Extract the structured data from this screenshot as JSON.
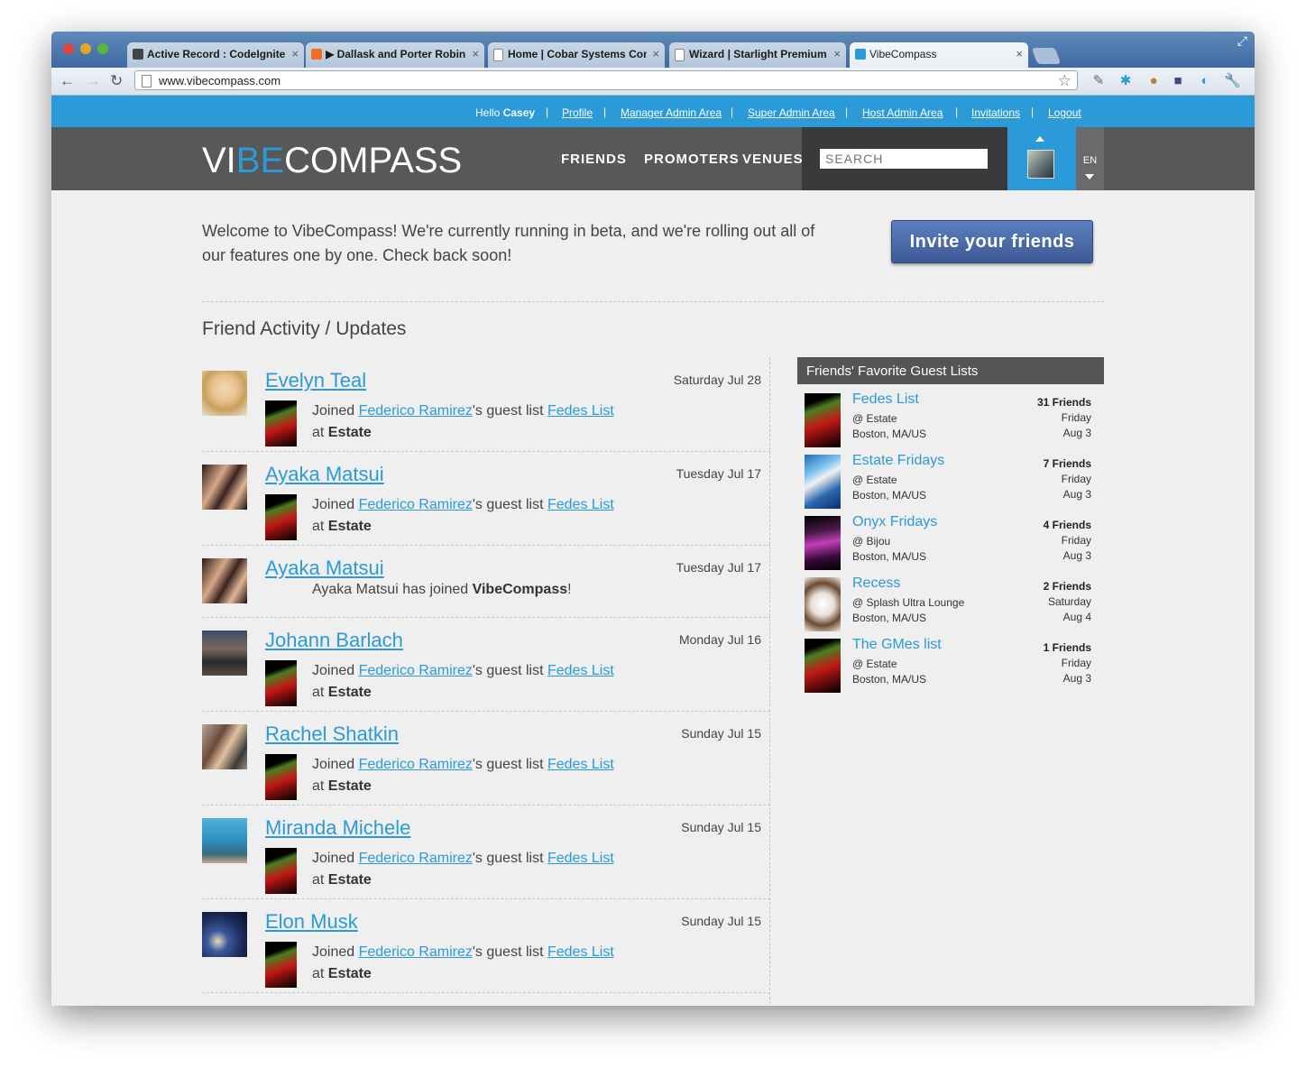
{
  "browser": {
    "tabs": [
      {
        "label": "Active Record : CodeIgniter U",
        "fav_color": "#444444"
      },
      {
        "label": "▶ Dallask and Porter Robinson",
        "fav_color": "#f26f21"
      },
      {
        "label": "Home | Cobar Systems Contr",
        "fav_color": "#ffffff"
      },
      {
        "label": "Wizard | Starlight Premium A",
        "fav_color": "#ffffff"
      },
      {
        "label": "VibeCompass",
        "fav_color": "#2a9ad8"
      }
    ],
    "url": "www.vibecompass.com"
  },
  "userbar": {
    "hello": "Hello",
    "user": "Casey",
    "links": [
      "Profile",
      "Manager Admin Area",
      "Super Admin Area",
      "Host Admin Area",
      "Invitations",
      "Logout"
    ]
  },
  "header": {
    "logo_pre": "VI",
    "logo_be": "BE",
    "logo_post": "COMPASS",
    "nav": [
      "FRIENDS",
      "PROMOTERS",
      "VENUES"
    ],
    "search_placeholder": "SEARCH",
    "lang": "EN"
  },
  "welcome": {
    "text": "Welcome to VibeCompass! We're currently running in beta, and we're rolling out all of our features one by one. Check back soon!",
    "invite_button": "Invite your friends"
  },
  "feed": {
    "title": "Friend Activity / Updates",
    "items": [
      {
        "name": "Evelyn Teal",
        "date": "Saturday Jul 28",
        "type": "joined_list",
        "host": "Federico Ramirez",
        "list": "Fedes List",
        "venue": "Estate"
      },
      {
        "name": "Ayaka Matsui",
        "date": "Tuesday Jul 17",
        "type": "joined_list",
        "host": "Federico Ramirez",
        "list": "Fedes List",
        "venue": "Estate"
      },
      {
        "name": "Ayaka Matsui",
        "date": "Tuesday Jul 17",
        "type": "joined_site",
        "text_pre": "Ayaka Matsui has joined",
        "text_brand": "VibeCompass",
        "text_post": "!"
      },
      {
        "name": "Johann Barlach",
        "date": "Monday Jul 16",
        "type": "joined_list",
        "host": "Federico Ramirez",
        "list": "Fedes List",
        "venue": "Estate"
      },
      {
        "name": "Rachel Shatkin",
        "date": "Sunday Jul 15",
        "type": "joined_list",
        "host": "Federico Ramirez",
        "list": "Fedes List",
        "venue": "Estate"
      },
      {
        "name": "Miranda Michele",
        "date": "Sunday Jul 15",
        "type": "joined_list",
        "host": "Federico Ramirez",
        "list": "Fedes List",
        "venue": "Estate"
      },
      {
        "name": "Elon Musk",
        "date": "Sunday Jul 15",
        "type": "joined_list",
        "host": "Federico Ramirez",
        "list": "Fedes List",
        "venue": "Estate"
      }
    ],
    "phrases": {
      "joined": "Joined",
      "guest_list": "'s guest list",
      "at": "at"
    }
  },
  "sidebar": {
    "title": "Friends' Favorite Guest Lists",
    "lists": [
      {
        "name": "Fedes List",
        "venue": "@ Estate",
        "city": "Boston, MA/US",
        "friends": "31 Friends",
        "day": "Friday",
        "date": "Aug 3"
      },
      {
        "name": "Estate Fridays",
        "venue": "@ Estate",
        "city": "Boston, MA/US",
        "friends": "7 Friends",
        "day": "Friday",
        "date": "Aug 3"
      },
      {
        "name": "Onyx Fridays",
        "venue": "@ Bijou",
        "city": "Boston, MA/US",
        "friends": "4 Friends",
        "day": "Friday",
        "date": "Aug 3"
      },
      {
        "name": "Recess",
        "venue": "@ Splash Ultra Lounge",
        "city": "Boston, MA/US",
        "friends": "2 Friends",
        "day": "Saturday",
        "date": "Aug 4"
      },
      {
        "name": "The GMes list",
        "venue": "@ Estate",
        "city": "Boston, MA/US",
        "friends": "1 Friends",
        "day": "Friday",
        "date": "Aug 3"
      }
    ]
  }
}
